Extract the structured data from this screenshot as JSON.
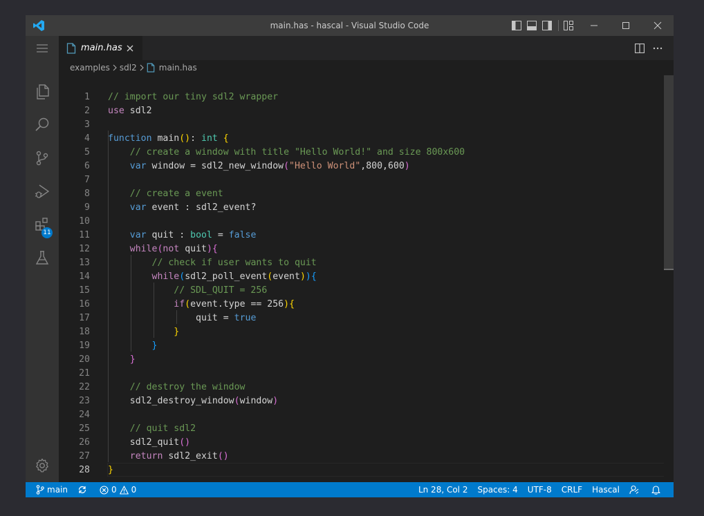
{
  "window": {
    "title": "main.has - hascal - Visual Studio Code"
  },
  "activity_bar": {
    "items": [
      {
        "name": "explorer-icon"
      },
      {
        "name": "search-icon"
      },
      {
        "name": "source-control-icon"
      },
      {
        "name": "run-debug-icon"
      },
      {
        "name": "extensions-icon"
      },
      {
        "name": "testing-icon"
      }
    ],
    "extensions_badge": "11"
  },
  "tabs": [
    {
      "label": "main.has",
      "active": true
    }
  ],
  "breadcrumb": [
    "examples",
    "sdl2",
    "main.has"
  ],
  "editor": {
    "active_line": 28,
    "lines": [
      {
        "n": "1"
      },
      {
        "n": "2"
      },
      {
        "n": "3"
      },
      {
        "n": "4"
      },
      {
        "n": "5"
      },
      {
        "n": "6"
      },
      {
        "n": "7"
      },
      {
        "n": "8"
      },
      {
        "n": "9"
      },
      {
        "n": "10"
      },
      {
        "n": "11"
      },
      {
        "n": "12"
      },
      {
        "n": "13"
      },
      {
        "n": "14"
      },
      {
        "n": "15"
      },
      {
        "n": "16"
      },
      {
        "n": "17"
      },
      {
        "n": "18"
      },
      {
        "n": "19"
      },
      {
        "n": "20"
      },
      {
        "n": "21"
      },
      {
        "n": "22"
      },
      {
        "n": "23"
      },
      {
        "n": "24"
      },
      {
        "n": "25"
      },
      {
        "n": "26"
      },
      {
        "n": "27"
      },
      {
        "n": "28"
      }
    ],
    "code": {
      "l1": "// import our tiny sdl2 wrapper",
      "l2a": "use",
      "l2b": " sdl2",
      "l4a": "function",
      "l4b": " main",
      "l4c": "()",
      "l4d": ": ",
      "l4e": "int",
      "l4f": " {",
      "l5": "// create a window with title \"Hello World!\" and size 800x600",
      "l6a": "var",
      "l6b": " window = sdl2_new_window",
      "l6c": "(",
      "l6d": "\"Hello World\"",
      "l6e": ",800,600",
      "l6f": ")",
      "l8": "// create a event",
      "l9a": "var",
      "l9b": " event : sdl2_event?",
      "l11a": "var",
      "l11b": " quit : ",
      "l11c": "bool",
      "l11d": " = ",
      "l11e": "false",
      "l12a": "while",
      "l12b": "(",
      "l12c": "not",
      "l12d": " quit",
      "l12e": ")",
      "l12f": "{",
      "l13": "// check if user wants to quit",
      "l14a": "while",
      "l14b": "(",
      "l14c": "sdl2_poll_event",
      "l14d": "(",
      "l14e": "event",
      "l14f": ")",
      "l14g": ")",
      "l14h": "{",
      "l15": "// SDL_QUIT = 256",
      "l16a": "if",
      "l16b": "(",
      "l16c": "event.type == 256",
      "l16d": ")",
      "l16e": "{",
      "l17a": "quit = ",
      "l17b": "true",
      "l18": "}",
      "l19": "}",
      "l20": "}",
      "l22": "// destroy the window",
      "l23a": "sdl2_destroy_window",
      "l23b": "(",
      "l23c": "window",
      "l23d": ")",
      "l25": "// quit sdl2",
      "l26a": "sdl2_quit",
      "l26b": "()",
      "l27a": "return",
      "l27b": " sdl2_exit",
      "l27c": "()",
      "l28": "}"
    }
  },
  "status_bar": {
    "branch": "main",
    "errors": "0",
    "warnings": "0",
    "position": "Ln 28, Col 2",
    "spaces": "Spaces: 4",
    "encoding": "UTF-8",
    "eol": "CRLF",
    "language": "Hascal"
  },
  "colors": {
    "accent": "#007acc",
    "comment": "#6a9955",
    "keyword": "#569cd6",
    "control": "#c586c0",
    "string": "#ce9178",
    "type": "#4ec9b0"
  }
}
